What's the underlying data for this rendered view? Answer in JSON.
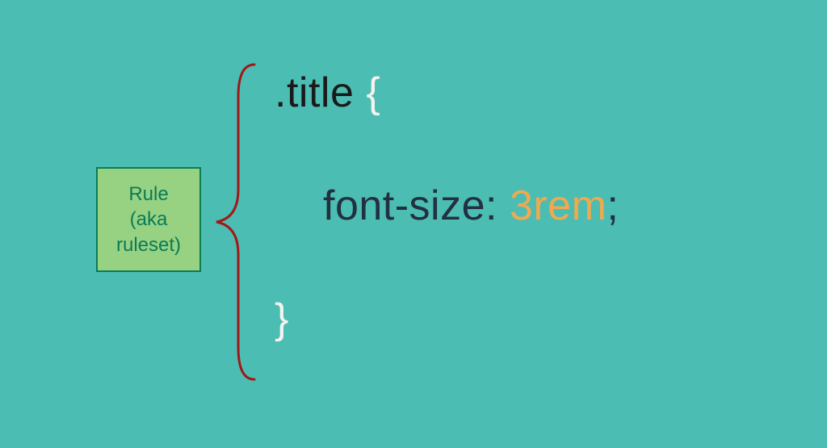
{
  "label": {
    "line1": "Rule",
    "line2": "(aka",
    "line3": "ruleset)"
  },
  "code": {
    "selector": ".title",
    "brace_open": "{",
    "property": "font-size",
    "colon": ":",
    "value": "3rem",
    "semicolon": ";",
    "brace_close": "}"
  },
  "colors": {
    "background": "#4cbdb2",
    "label_bg": "#97d283",
    "label_border": "#0b7b55",
    "bracket": "#a01818",
    "selector": "#1a1a1a",
    "brace": "#f5f3ee",
    "prop": "#223040",
    "value": "#f0a94f"
  }
}
